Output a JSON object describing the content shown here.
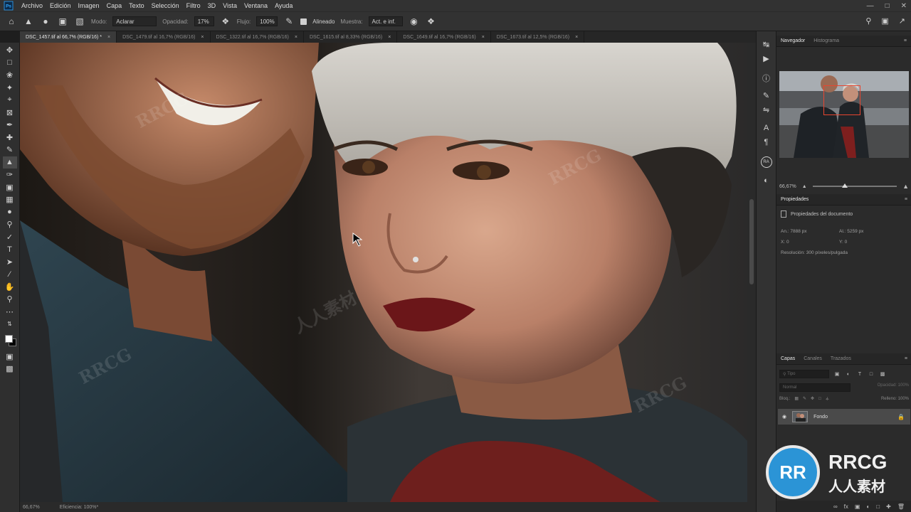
{
  "menubar": {
    "app_logo": "Ps",
    "items": [
      "Archivo",
      "Edición",
      "Imagen",
      "Capa",
      "Texto",
      "Selección",
      "Filtro",
      "3D",
      "Vista",
      "Ventana",
      "Ayuda"
    ]
  },
  "options": {
    "mode_label": "Modo:",
    "mode_value": "Aclarar",
    "opacity_label": "Opacidad:",
    "opacity_value": "17%",
    "flow_label": "Flujo:",
    "flow_value": "100%",
    "aligned_label": "Alineado",
    "sample_label": "Muestra:",
    "sample_value": "Act. e inf."
  },
  "tabs": [
    {
      "label": "DSC_1457.tif al 66,7% (RGB/16) *"
    },
    {
      "label": "DSC_1479.tif al 16,7% (RGB/16)"
    },
    {
      "label": "DSC_1322.tif al 16,7% (RGB/16)"
    },
    {
      "label": "DSC_1615.tif al 8,33% (RGB/16)"
    },
    {
      "label": "DSC_1649.tif al 16,7% (RGB/16)"
    },
    {
      "label": "DSC_1673.tif al 12,5% (RGB/16)"
    }
  ],
  "navigator": {
    "tab_active": "Navegador",
    "tab_other": "Histograma",
    "zoom": "66,67%",
    "zoom_fraction": 0.38
  },
  "properties": {
    "tab": "Propiedades",
    "title": "Propiedades del documento",
    "an_label": "An.:",
    "an_value": "7888 px",
    "al_label": "Al.:",
    "al_value": "5259 px",
    "x_label": "X:",
    "x_value": "0",
    "y_label": "Y:",
    "y_value": "0",
    "resolution": "Resolución: 300 píxeles/pulgada"
  },
  "layers": {
    "tab_active": "Capas",
    "tab2": "Canales",
    "tab3": "Trazados",
    "filter_placeholder": "Tipo",
    "blend_mode": "Normal",
    "opacity_label": "Opacidad:",
    "opacity_value": "100%",
    "lock_label": "Bloq.:",
    "fill_label": "Relleno:",
    "fill_value": "100%",
    "layer_name": "Fondo"
  },
  "statusbar": {
    "zoom": "66,67%",
    "info": "Eficiencia: 100%*"
  },
  "watermark": {
    "logo_text": "RRCG",
    "logo_sub": "人人素材"
  }
}
